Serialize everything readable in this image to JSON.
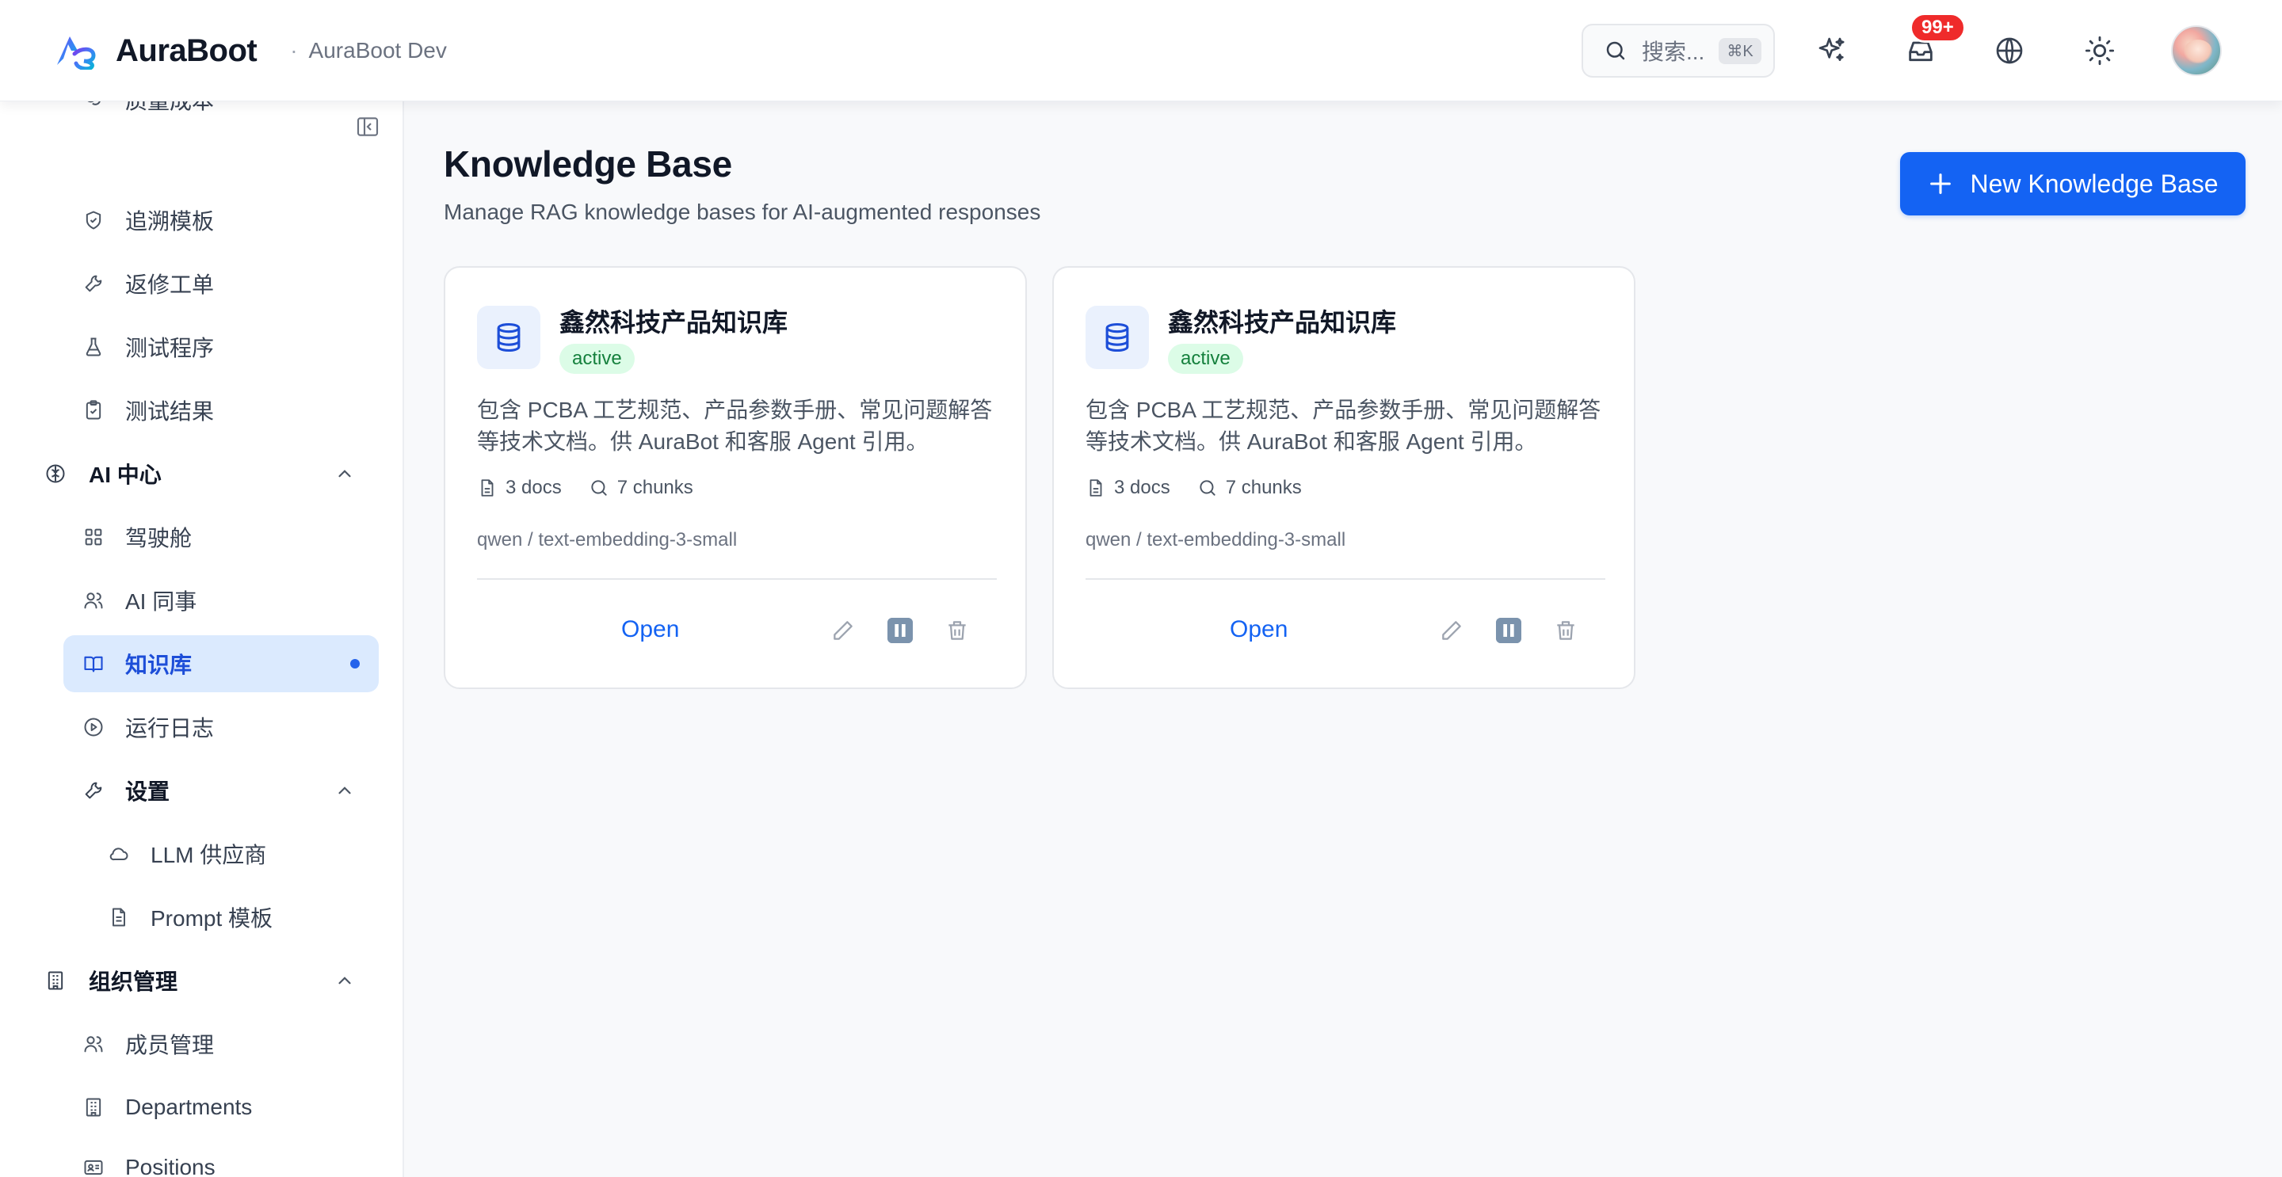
{
  "header": {
    "brand_name": "AuraBoot",
    "separator": "·",
    "env_name": "AuraBoot Dev",
    "search_placeholder": "搜索...",
    "search_shortcut": "⌘K",
    "inbox_badge": "99+",
    "icons": [
      "sparkles-icon",
      "inbox-icon",
      "globe-icon",
      "sun-icon"
    ]
  },
  "sidebar": {
    "items_top": [
      {
        "label": "质量成本",
        "icon": "coins-icon"
      },
      {
        "label": "追溯模板",
        "icon": "shield-icon"
      },
      {
        "label": "返修工单",
        "icon": "wrench-icon"
      },
      {
        "label": "测试程序",
        "icon": "flask-icon"
      },
      {
        "label": "测试结果",
        "icon": "clipboard-check-icon"
      }
    ],
    "ai_group": {
      "label": "AI 中心",
      "icon": "brain-icon"
    },
    "ai_items": [
      {
        "label": "驾驶舱",
        "icon": "dashboard-icon"
      },
      {
        "label": "AI 同事",
        "icon": "users-icon"
      },
      {
        "label": "知识库",
        "icon": "book-open-icon",
        "active": true
      },
      {
        "label": "运行日志",
        "icon": "play-circle-icon"
      }
    ],
    "settings_group": {
      "label": "设置",
      "icon": "wrench-icon"
    },
    "settings_items": [
      {
        "label": "LLM 供应商",
        "icon": "cloud-icon"
      },
      {
        "label": "Prompt 模板",
        "icon": "file-text-icon"
      }
    ],
    "org_group": {
      "label": "组织管理",
      "icon": "building-icon"
    },
    "org_items": [
      {
        "label": "成员管理",
        "icon": "users-icon"
      },
      {
        "label": "Departments",
        "icon": "building-icon"
      },
      {
        "label": "Positions",
        "icon": "id-card-icon"
      }
    ]
  },
  "main": {
    "title": "Knowledge Base",
    "subtitle": "Manage RAG knowledge bases for AI-augmented responses",
    "new_button_label": "New Knowledge Base",
    "cards": [
      {
        "title": "鑫然科技产品知识库",
        "status": "active",
        "description": "包含 PCBA 工艺规范、产品参数手册、常见问题解答等技术文档。供 AuraBot 和客服 Agent 引用。",
        "docs": "3 docs",
        "chunks": "7 chunks",
        "model": "qwen / text-embedding-3-small",
        "open_label": "Open"
      },
      {
        "title": "鑫然科技产品知识库",
        "status": "active",
        "description": "包含 PCBA 工艺规范、产品参数手册、常见问题解答等技术文档。供 AuraBot 和客服 Agent 引用。",
        "docs": "3 docs",
        "chunks": "7 chunks",
        "model": "qwen / text-embedding-3-small",
        "open_label": "Open"
      }
    ]
  },
  "colors": {
    "accent": "#1463f3",
    "active_bg": "#dbeafe",
    "status_bg": "#dcfce7",
    "status_text": "#15803d",
    "badge": "#ef2b2b"
  }
}
